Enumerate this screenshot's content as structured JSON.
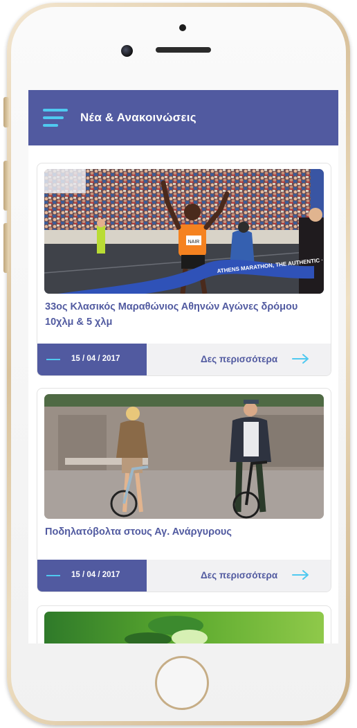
{
  "header": {
    "title": "Νέα & Ανακοινώσεις"
  },
  "news": [
    {
      "title": "33ος Κλασικός Μαραθώνιος Αθηνών Αγώνες δρόμου 10χλμ & 5 χλμ",
      "date": "15 / 04 / 2017",
      "more_label": "Δες περισσότερα",
      "banner_text": "ATHENS MARATHON, THE AUTHENTIC · ΜΑΡΑΘΩΝΙΟΣ, Ο ΑΥΘΕΝΤΙΚΟΣ",
      "bib_text": "NAIR"
    },
    {
      "title": "Ποδηλατόβολτα στους Αγ. Ανάργυρους",
      "date": "15 / 04 / 2017",
      "more_label": "Δες περισσότερα"
    }
  ],
  "colors": {
    "primary": "#515aa0",
    "accent": "#4fc9f0",
    "footer_bg": "#f1f1f3"
  },
  "icons": [
    "menu-icon",
    "arrow-right-icon"
  ]
}
